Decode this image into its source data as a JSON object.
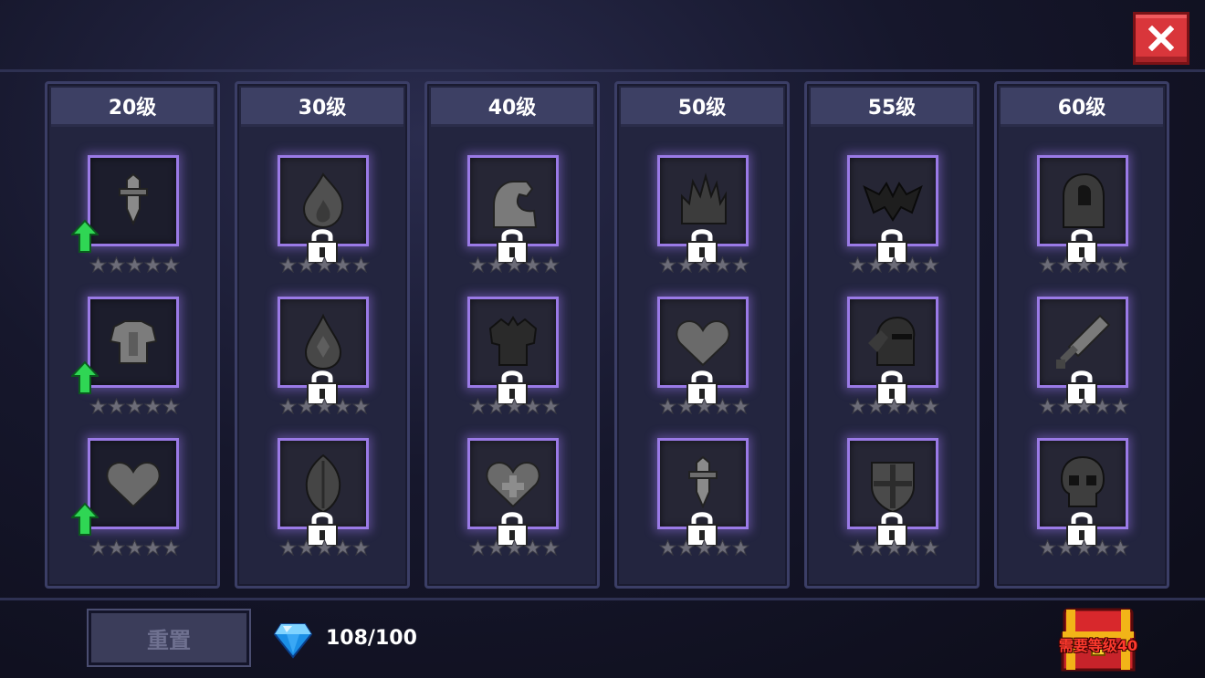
{
  "columns": [
    {
      "title": "20级",
      "skills": [
        {
          "icon": "sword-icon",
          "locked": false,
          "upgradable": true,
          "stars": 0
        },
        {
          "icon": "chest-armor-icon",
          "locked": false,
          "upgradable": true,
          "stars": 0
        },
        {
          "icon": "heart-icon",
          "locked": false,
          "upgradable": true,
          "stars": 0
        }
      ]
    },
    {
      "title": "30级",
      "skills": [
        {
          "icon": "flame-icon",
          "locked": true,
          "upgradable": false,
          "stars": 0
        },
        {
          "icon": "water-drop-icon",
          "locked": true,
          "upgradable": false,
          "stars": 0
        },
        {
          "icon": "leaf-icon",
          "locked": true,
          "upgradable": false,
          "stars": 0
        }
      ]
    },
    {
      "title": "40级",
      "skills": [
        {
          "icon": "flexed-arm-icon",
          "locked": true,
          "upgradable": false,
          "stars": 0
        },
        {
          "icon": "spiky-armor-icon",
          "locked": true,
          "upgradable": false,
          "stars": 0
        },
        {
          "icon": "heart-plus-icon",
          "locked": true,
          "upgradable": false,
          "stars": 0
        }
      ]
    },
    {
      "title": "50级",
      "skills": [
        {
          "icon": "dark-flame-icon",
          "locked": true,
          "upgradable": false,
          "stars": 0
        },
        {
          "icon": "heart-icon",
          "locked": true,
          "upgradable": false,
          "stars": 0
        },
        {
          "icon": "sword-icon",
          "locked": true,
          "upgradable": false,
          "stars": 0
        }
      ]
    },
    {
      "title": "55级",
      "skills": [
        {
          "icon": "bat-icon",
          "locked": true,
          "upgradable": false,
          "stars": 0
        },
        {
          "icon": "knight-helmet-icon",
          "locked": true,
          "upgradable": false,
          "stars": 0
        },
        {
          "icon": "shield-icon",
          "locked": true,
          "upgradable": false,
          "stars": 0
        }
      ]
    },
    {
      "title": "60级",
      "skills": [
        {
          "icon": "hooded-figure-icon",
          "locked": true,
          "upgradable": false,
          "stars": 0
        },
        {
          "icon": "broadsword-icon",
          "locked": true,
          "upgradable": false,
          "stars": 0
        },
        {
          "icon": "skull-icon",
          "locked": true,
          "upgradable": false,
          "stars": 0
        }
      ]
    }
  ],
  "footer": {
    "reset_label": "重置",
    "gems_text": "108/100",
    "chest_label": "需要等级40"
  },
  "colors": {
    "frame_border": "#9a7ae6",
    "close_button": "#d9363b",
    "upgrade_arrow": "#2fd654",
    "chest_label": "#ff3a2e"
  }
}
